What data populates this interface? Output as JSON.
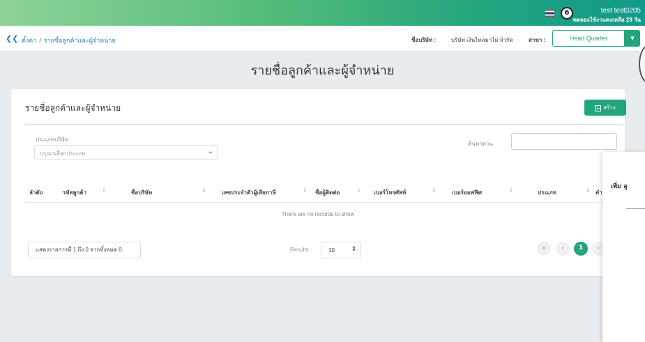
{
  "header": {
    "user_name": "test test0205",
    "trial_text": "ทดลองใช้งานคงเหลือ 29 วัน",
    "coin_label": "6"
  },
  "subbar": {
    "breadcrumb_root": "ตั้งค่า",
    "breadcrumb_sep": "/",
    "breadcrumb_current": "รายชื่อลูกค้าและผู้จำหน่าย",
    "company_label": "ชื่อบริษัท :",
    "company_value": "บริษัท เงินไหลมาไม่ จำกัด",
    "branch_label": "สาขา :",
    "branch_value": "Head Quarter"
  },
  "page_title": "รายชื่อลูกค้าและผู้จำหน่าย",
  "card": {
    "title": "รายชื่อลูกค้าและผู้จำหน่าย",
    "create_label": "สร้าง",
    "filter": {
      "type_label": "ประเภทบริษัท",
      "type_placeholder": "กรุณาเลือกประเภท",
      "search_label": "ค้นหาด่วน",
      "search_value": ""
    },
    "columns": [
      "ลำดับ",
      "รหัสลูกค้า",
      "ชื่อบริษัท",
      "เลขประจำตัวผู้เสียภาษี",
      "ชื่อผู้ติดต่อ",
      "เบอร์โทรศัพท์",
      "เบอร์ออฟฟิศ",
      "ประเภท",
      "ตำ"
    ],
    "empty_message": "There are no records to show",
    "summary": "แสดงรายการที่ 1 ถึง 0 จากทั้งหมด 0",
    "results_label": "Results :",
    "results_value": "10",
    "current_page": "1"
  },
  "panel": {
    "title": "เพิ่ม ลู"
  },
  "colors": {
    "accent": "#22a47e",
    "link": "#2a7fb7",
    "background": "#e9ecef"
  }
}
